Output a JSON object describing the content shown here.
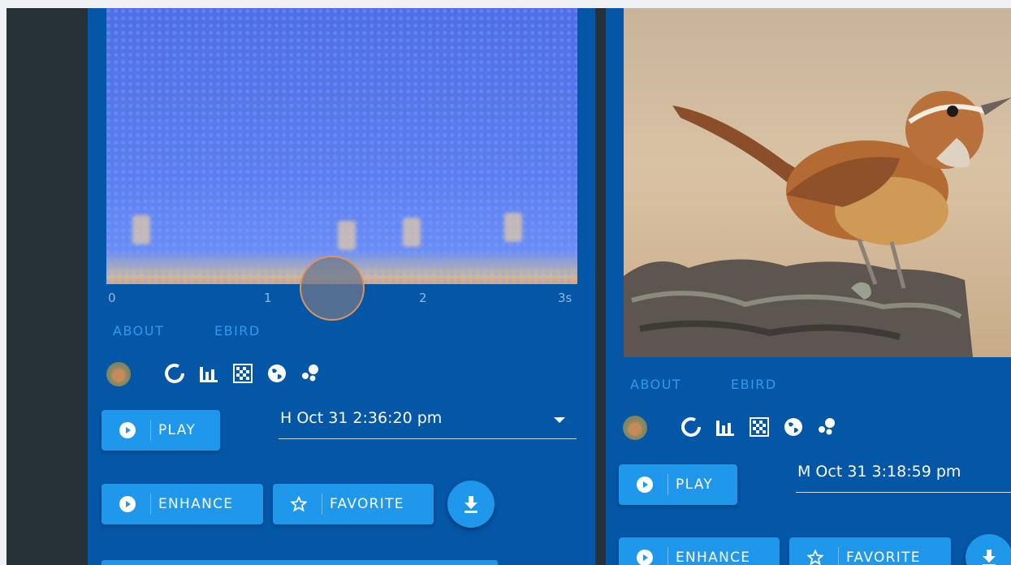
{
  "cards": [
    {
      "spectrogram": {
        "axis_ticks": [
          "0",
          "1",
          "2",
          "3s"
        ]
      },
      "links": {
        "about": "ABOUT",
        "ebird": "EBIRD"
      },
      "icons": [
        "bird-avatar",
        "donut-chart-icon",
        "bar-chart-icon",
        "checkerboard-icon",
        "globe-icon",
        "scatter-dots-icon"
      ],
      "play_label": "PLAY",
      "recording_select": "H Oct 31 2:36:20 pm",
      "enhance_label": "ENHANCE",
      "favorite_label": "FAVORITE"
    },
    {
      "links": {
        "about": "ABOUT",
        "ebird": "EBIRD"
      },
      "icons": [
        "bird-avatar",
        "donut-chart-icon",
        "bar-chart-icon",
        "checkerboard-icon",
        "globe-icon",
        "scatter-dots-icon"
      ],
      "play_label": "PLAY",
      "recording_select": "M Oct 31 3:18:59 pm",
      "enhance_label": "ENHANCE",
      "favorite_label": "FAVORITE"
    }
  ],
  "colors": {
    "card": "#0456a6",
    "button": "#1f97ea",
    "link": "#2e9bf0",
    "sidebar": "#263238"
  }
}
